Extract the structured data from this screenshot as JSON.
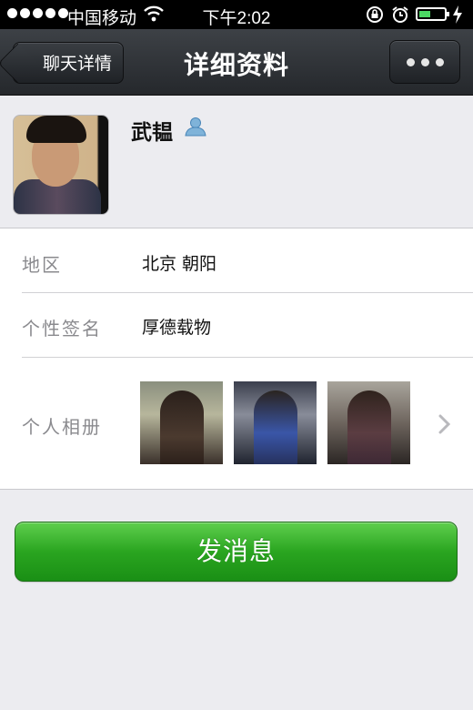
{
  "status_bar": {
    "carrier": "中国移动",
    "time": "下午2:02",
    "battery_level": 0.4
  },
  "nav": {
    "back_label": "聊天详情",
    "title": "详细资料",
    "more_icon": "ellipsis-icon"
  },
  "profile": {
    "name": "武韫",
    "badge_icon": "person-icon"
  },
  "info": {
    "region_label": "地区",
    "region_value": "北京 朝阳",
    "signature_label": "个性签名",
    "signature_value": "厚德载物",
    "album_label": "个人相册"
  },
  "actions": {
    "send_label": "发消息"
  },
  "colors": {
    "nav_bg": "#2f3237",
    "send_green": "#2aa520",
    "page_bg": "#ececf0"
  }
}
